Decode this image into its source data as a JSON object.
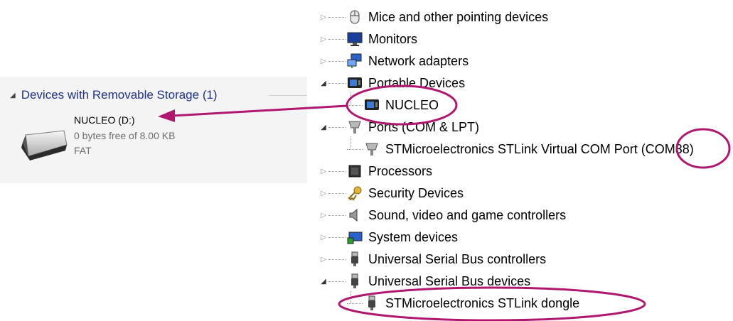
{
  "explorer": {
    "group_header": "Devices with Removable Storage (1)",
    "drive": {
      "name": "NUCLEO (D:)",
      "free_space": "0 bytes free of 8.00 KB",
      "filesystem": "FAT",
      "icon": "removable-drive-icon"
    }
  },
  "device_tree": {
    "items": [
      {
        "label": "Mice and other pointing devices",
        "icon": "mouse-icon",
        "expanded": false
      },
      {
        "label": "Monitors",
        "icon": "monitor-icon",
        "expanded": false
      },
      {
        "label": "Network adapters",
        "icon": "network-icon",
        "expanded": false
      },
      {
        "label": "Portable Devices",
        "icon": "portable-device-icon",
        "expanded": true,
        "children": [
          {
            "label": "NUCLEO",
            "icon": "portable-device-icon"
          }
        ]
      },
      {
        "label": "Ports (COM & LPT)",
        "icon": "port-icon",
        "expanded": true,
        "children": [
          {
            "label": "STMicroelectronics STLink Virtual COM Port (COM38)",
            "icon": "port-icon"
          }
        ]
      },
      {
        "label": "Processors",
        "icon": "processor-icon",
        "expanded": false
      },
      {
        "label": "Security Devices",
        "icon": "key-icon",
        "expanded": false
      },
      {
        "label": "Sound, video and game controllers",
        "icon": "speaker-icon",
        "expanded": false
      },
      {
        "label": "System devices",
        "icon": "system-icon",
        "expanded": false
      },
      {
        "label": "Universal Serial Bus controllers",
        "icon": "usb-icon",
        "expanded": false
      },
      {
        "label": "Universal Serial Bus devices",
        "icon": "usb-icon",
        "expanded": true,
        "children": [
          {
            "label": "STMicroelectronics STLink dongle",
            "icon": "usb-icon"
          }
        ]
      }
    ]
  },
  "annotation_color": "#b0176f"
}
